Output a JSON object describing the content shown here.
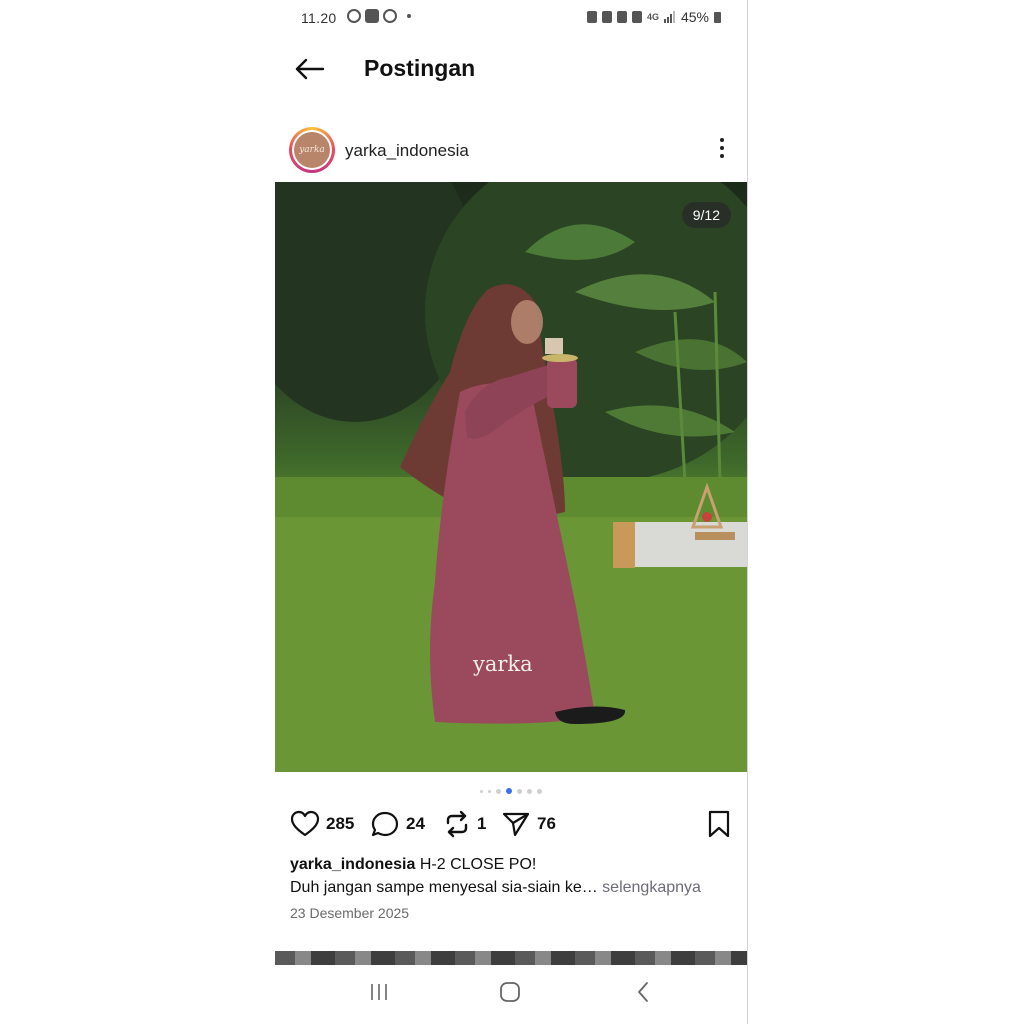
{
  "status_bar": {
    "time": "11.20",
    "battery": "45%",
    "network": "4G"
  },
  "header": {
    "title": "Postingan"
  },
  "post": {
    "username": "yarka_indonesia",
    "avatar_text": "yarka",
    "image_counter": "9/12",
    "watermark": "yarka",
    "carousel": {
      "current": 9,
      "total": 12
    },
    "stats": {
      "likes": "285",
      "comments": "24",
      "reposts": "1",
      "shares": "76"
    },
    "caption": {
      "username": "yarka_indonesia",
      "headline": "H-2 CLOSE PO!",
      "preview": "Duh jangan sampe menyesal sia-siain ke…",
      "more_label": "selengkapnya"
    },
    "date": "23 Desember 2025"
  },
  "colors": {
    "accent_dot": "#3a6ff2",
    "muted_text": "#6b6b6b",
    "robe": "#9b4a5e",
    "hijab": "#6e3b34",
    "grass": "#6a9636"
  },
  "icons": {
    "back": "arrow-left-icon",
    "more": "more-vertical-icon",
    "like": "heart-icon",
    "comment": "comment-icon",
    "repost": "repost-icon",
    "share": "send-icon",
    "save": "bookmark-icon"
  }
}
